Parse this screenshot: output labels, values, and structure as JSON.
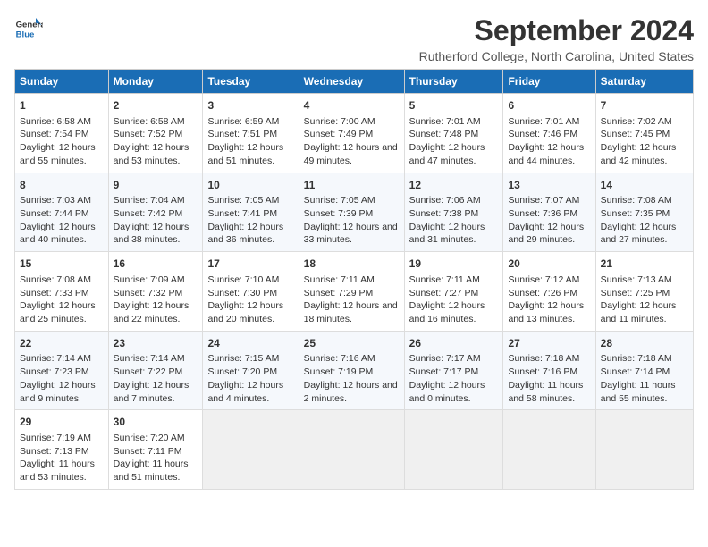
{
  "logo": {
    "line1": "General",
    "line2": "Blue"
  },
  "title": "September 2024",
  "subtitle": "Rutherford College, North Carolina, United States",
  "days_of_week": [
    "Sunday",
    "Monday",
    "Tuesday",
    "Wednesday",
    "Thursday",
    "Friday",
    "Saturday"
  ],
  "weeks": [
    [
      {
        "day": "1",
        "sunrise": "6:58 AM",
        "sunset": "7:54 PM",
        "daylight": "12 hours and 55 minutes."
      },
      {
        "day": "2",
        "sunrise": "6:58 AM",
        "sunset": "7:52 PM",
        "daylight": "12 hours and 53 minutes."
      },
      {
        "day": "3",
        "sunrise": "6:59 AM",
        "sunset": "7:51 PM",
        "daylight": "12 hours and 51 minutes."
      },
      {
        "day": "4",
        "sunrise": "7:00 AM",
        "sunset": "7:49 PM",
        "daylight": "12 hours and 49 minutes."
      },
      {
        "day": "5",
        "sunrise": "7:01 AM",
        "sunset": "7:48 PM",
        "daylight": "12 hours and 47 minutes."
      },
      {
        "day": "6",
        "sunrise": "7:01 AM",
        "sunset": "7:46 PM",
        "daylight": "12 hours and 44 minutes."
      },
      {
        "day": "7",
        "sunrise": "7:02 AM",
        "sunset": "7:45 PM",
        "daylight": "12 hours and 42 minutes."
      }
    ],
    [
      {
        "day": "8",
        "sunrise": "7:03 AM",
        "sunset": "7:44 PM",
        "daylight": "12 hours and 40 minutes."
      },
      {
        "day": "9",
        "sunrise": "7:04 AM",
        "sunset": "7:42 PM",
        "daylight": "12 hours and 38 minutes."
      },
      {
        "day": "10",
        "sunrise": "7:05 AM",
        "sunset": "7:41 PM",
        "daylight": "12 hours and 36 minutes."
      },
      {
        "day": "11",
        "sunrise": "7:05 AM",
        "sunset": "7:39 PM",
        "daylight": "12 hours and 33 minutes."
      },
      {
        "day": "12",
        "sunrise": "7:06 AM",
        "sunset": "7:38 PM",
        "daylight": "12 hours and 31 minutes."
      },
      {
        "day": "13",
        "sunrise": "7:07 AM",
        "sunset": "7:36 PM",
        "daylight": "12 hours and 29 minutes."
      },
      {
        "day": "14",
        "sunrise": "7:08 AM",
        "sunset": "7:35 PM",
        "daylight": "12 hours and 27 minutes."
      }
    ],
    [
      {
        "day": "15",
        "sunrise": "7:08 AM",
        "sunset": "7:33 PM",
        "daylight": "12 hours and 25 minutes."
      },
      {
        "day": "16",
        "sunrise": "7:09 AM",
        "sunset": "7:32 PM",
        "daylight": "12 hours and 22 minutes."
      },
      {
        "day": "17",
        "sunrise": "7:10 AM",
        "sunset": "7:30 PM",
        "daylight": "12 hours and 20 minutes."
      },
      {
        "day": "18",
        "sunrise": "7:11 AM",
        "sunset": "7:29 PM",
        "daylight": "12 hours and 18 minutes."
      },
      {
        "day": "19",
        "sunrise": "7:11 AM",
        "sunset": "7:27 PM",
        "daylight": "12 hours and 16 minutes."
      },
      {
        "day": "20",
        "sunrise": "7:12 AM",
        "sunset": "7:26 PM",
        "daylight": "12 hours and 13 minutes."
      },
      {
        "day": "21",
        "sunrise": "7:13 AM",
        "sunset": "7:25 PM",
        "daylight": "12 hours and 11 minutes."
      }
    ],
    [
      {
        "day": "22",
        "sunrise": "7:14 AM",
        "sunset": "7:23 PM",
        "daylight": "12 hours and 9 minutes."
      },
      {
        "day": "23",
        "sunrise": "7:14 AM",
        "sunset": "7:22 PM",
        "daylight": "12 hours and 7 minutes."
      },
      {
        "day": "24",
        "sunrise": "7:15 AM",
        "sunset": "7:20 PM",
        "daylight": "12 hours and 4 minutes."
      },
      {
        "day": "25",
        "sunrise": "7:16 AM",
        "sunset": "7:19 PM",
        "daylight": "12 hours and 2 minutes."
      },
      {
        "day": "26",
        "sunrise": "7:17 AM",
        "sunset": "7:17 PM",
        "daylight": "12 hours and 0 minutes."
      },
      {
        "day": "27",
        "sunrise": "7:18 AM",
        "sunset": "7:16 PM",
        "daylight": "11 hours and 58 minutes."
      },
      {
        "day": "28",
        "sunrise": "7:18 AM",
        "sunset": "7:14 PM",
        "daylight": "11 hours and 55 minutes."
      }
    ],
    [
      {
        "day": "29",
        "sunrise": "7:19 AM",
        "sunset": "7:13 PM",
        "daylight": "11 hours and 53 minutes."
      },
      {
        "day": "30",
        "sunrise": "7:20 AM",
        "sunset": "7:11 PM",
        "daylight": "11 hours and 51 minutes."
      },
      {
        "day": "",
        "sunrise": "",
        "sunset": "",
        "daylight": ""
      },
      {
        "day": "",
        "sunrise": "",
        "sunset": "",
        "daylight": ""
      },
      {
        "day": "",
        "sunrise": "",
        "sunset": "",
        "daylight": ""
      },
      {
        "day": "",
        "sunrise": "",
        "sunset": "",
        "daylight": ""
      },
      {
        "day": "",
        "sunrise": "",
        "sunset": "",
        "daylight": ""
      }
    ]
  ]
}
